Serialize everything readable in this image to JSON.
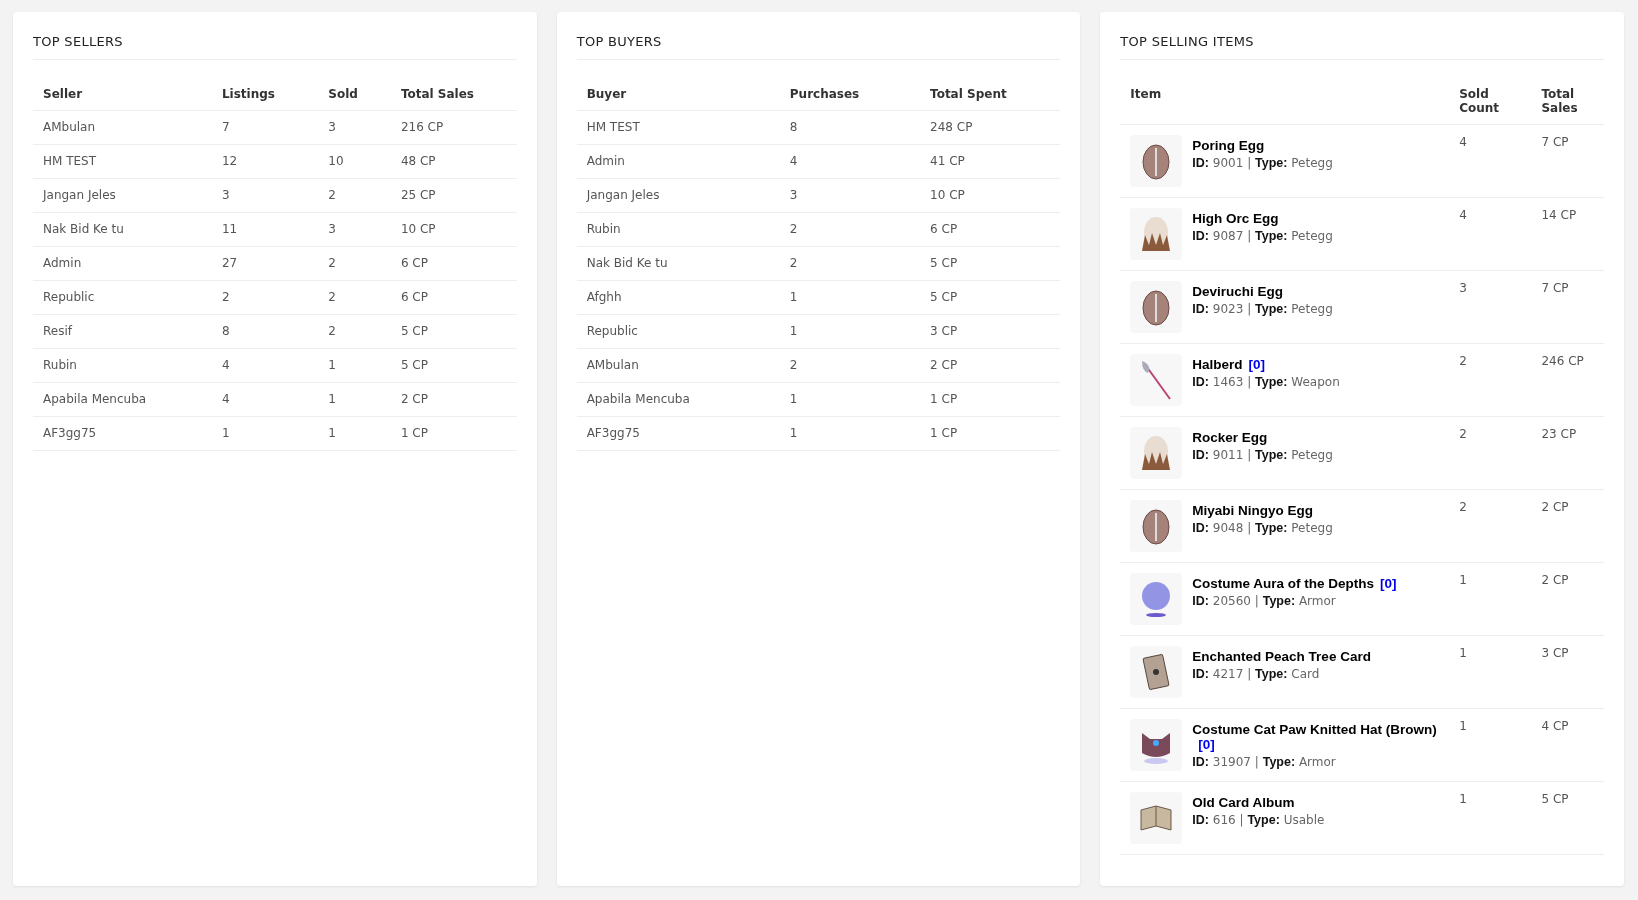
{
  "top_sellers": {
    "title": "TOP SELLERS",
    "columns": [
      "Seller",
      "Listings",
      "Sold",
      "Total Sales"
    ],
    "rows": [
      [
        "AMbulan",
        "7",
        "3",
        "216 CP"
      ],
      [
        "HM TEST",
        "12",
        "10",
        "48 CP"
      ],
      [
        "Jangan Jeles",
        "3",
        "2",
        "25 CP"
      ],
      [
        "Nak Bid Ke tu",
        "11",
        "3",
        "10 CP"
      ],
      [
        "Admin",
        "27",
        "2",
        "6 CP"
      ],
      [
        "Republic",
        "2",
        "2",
        "6 CP"
      ],
      [
        "Resif",
        "8",
        "2",
        "5 CP"
      ],
      [
        "Rubin",
        "4",
        "1",
        "5 CP"
      ],
      [
        "Apabila Mencuba",
        "4",
        "1",
        "2 CP"
      ],
      [
        "AF3gg75",
        "1",
        "1",
        "1 CP"
      ]
    ]
  },
  "top_buyers": {
    "title": "TOP BUYERS",
    "columns": [
      "Buyer",
      "Purchases",
      "Total Spent"
    ],
    "rows": [
      [
        "HM TEST",
        "8",
        "248 CP"
      ],
      [
        "Admin",
        "4",
        "41 CP"
      ],
      [
        "Jangan Jeles",
        "3",
        "10 CP"
      ],
      [
        "Rubin",
        "2",
        "6 CP"
      ],
      [
        "Nak Bid Ke tu",
        "2",
        "5 CP"
      ],
      [
        "Afghh",
        "1",
        "5 CP"
      ],
      [
        "Republic",
        "1",
        "3 CP"
      ],
      [
        "AMbulan",
        "2",
        "2 CP"
      ],
      [
        "Apabila Mencuba",
        "1",
        "1 CP"
      ],
      [
        "AF3gg75",
        "1",
        "1 CP"
      ]
    ]
  },
  "top_selling_items": {
    "title": "TOP SELLING ITEMS",
    "columns": [
      "Item",
      "Sold Count",
      "Total Sales"
    ],
    "items": [
      {
        "kind": "egg",
        "name": "Poring Egg",
        "details": "**ID:** 9001 | **Type:** Petegg",
        "sold_count": "4",
        "total_sales": "7 CP"
      },
      {
        "kind": "spiky-egg",
        "name": "High Orc Egg",
        "details": "**ID:** 9087 | **Type:** Petegg",
        "sold_count": "4",
        "total_sales": "14 CP"
      },
      {
        "kind": "egg",
        "name": "Deviruchi Egg",
        "details": "**ID:** 9023 | **Type:** Petegg",
        "sold_count": "3",
        "total_sales": "7 CP"
      },
      {
        "kind": "axe",
        "name": "Halberd",
        "slots": "[0]",
        "details": "**ID:** 1463 | **Type:** Weapon",
        "sold_count": "2",
        "total_sales": "246 CP"
      },
      {
        "kind": "spiky-egg",
        "name": "Rocker Egg",
        "details": "**ID:** 9011 | **Type:** Petegg",
        "sold_count": "2",
        "total_sales": "23 CP"
      },
      {
        "kind": "egg",
        "name": "Miyabi Ningyo Egg",
        "details": "**ID:** 9048 | **Type:** Petegg",
        "sold_count": "2",
        "total_sales": "2 CP"
      },
      {
        "kind": "aura",
        "name": "Costume Aura of the Depths",
        "slots": "[0]",
        "details": "**ID:** 20560 | **Type:** Armor",
        "sold_count": "1",
        "total_sales": "2 CP"
      },
      {
        "kind": "card",
        "name": "Enchanted Peach Tree Card",
        "details": "**ID:** 4217 | **Type:** Card",
        "sold_count": "1",
        "total_sales": "3 CP"
      },
      {
        "kind": "hat",
        "name": "Costume Cat Paw Knitted Hat (Brown)",
        "slots": "[0]",
        "details": "**ID:** 31907 | **Type:** Armor",
        "sold_count": "1",
        "total_sales": "4 CP"
      },
      {
        "kind": "book",
        "name": "Old Card Album",
        "details": "**ID:** 616 | **Type:** Usable",
        "sold_count": "1",
        "total_sales": "5 CP"
      }
    ]
  }
}
